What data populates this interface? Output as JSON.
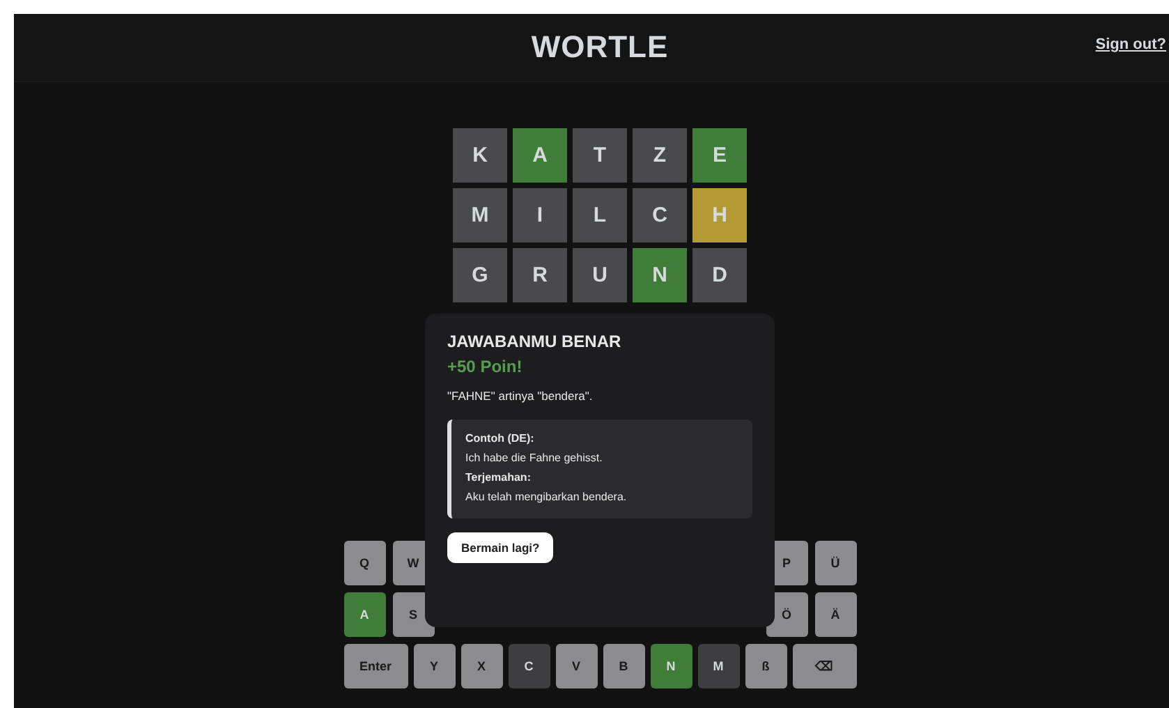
{
  "header": {
    "title": "WORTLE",
    "sign_out": "Sign out?"
  },
  "board": [
    [
      {
        "letter": "K",
        "color": "#4a4a4c"
      },
      {
        "letter": "A",
        "color": "#3f7d38"
      },
      {
        "letter": "T",
        "color": "#4a4a4c"
      },
      {
        "letter": "Z",
        "color": "#4a4a4c"
      },
      {
        "letter": "E",
        "color": "#3f7d38"
      }
    ],
    [
      {
        "letter": "M",
        "color": "#4a4a4c"
      },
      {
        "letter": "I",
        "color": "#4a4a4c"
      },
      {
        "letter": "L",
        "color": "#4a4a4c"
      },
      {
        "letter": "C",
        "color": "#4a4a4c"
      },
      {
        "letter": "H",
        "color": "#b29a35"
      }
    ],
    [
      {
        "letter": "G",
        "color": "#4a4a4c"
      },
      {
        "letter": "R",
        "color": "#4a4a4c"
      },
      {
        "letter": "U",
        "color": "#4a4a4c"
      },
      {
        "letter": "N",
        "color": "#3f7d38"
      },
      {
        "letter": "D",
        "color": "#4a4a4c"
      }
    ]
  ],
  "keyboard": [
    {
      "left": [
        {
          "label": "Q",
          "color": "#8c8c8e"
        },
        {
          "label": "W",
          "color": "#8c8c8e"
        }
      ],
      "right": [
        {
          "label": "P",
          "color": "#8c8c8e"
        },
        {
          "label": "Ü",
          "color": "#8c8c8e"
        }
      ]
    },
    {
      "left": [
        {
          "label": "A",
          "color": "#3f7d38"
        },
        {
          "label": "S",
          "color": "#8c8c8e"
        }
      ],
      "right": [
        {
          "label": "Ö",
          "color": "#8c8c8e"
        },
        {
          "label": "Ä",
          "color": "#8c8c8e"
        }
      ]
    },
    {
      "left": [
        {
          "label": "Enter",
          "color": "#8c8c8e",
          "kind": "wide"
        },
        {
          "label": "Y",
          "color": "#8c8c8e"
        },
        {
          "label": "X",
          "color": "#8c8c8e"
        },
        {
          "label": "C",
          "color": "#3e3e40"
        },
        {
          "label": "V",
          "color": "#8c8c8e"
        },
        {
          "label": "B",
          "color": "#8c8c8e"
        },
        {
          "label": "N",
          "color": "#3f7d38"
        },
        {
          "label": "M",
          "color": "#3e3e40"
        },
        {
          "label": "ß",
          "color": "#8c8c8e"
        },
        {
          "label": "⌫",
          "color": "#8c8c8e",
          "kind": "wide"
        }
      ]
    }
  ],
  "result_dialog": {
    "title": "JAWABANMU BENAR",
    "points": "+50 Poin!",
    "meaning": "\"FAHNE\" artinya \"bendera\".",
    "example_label": "Contoh (DE):",
    "example": "Ich habe die Fahne gehisst.",
    "translation_label": "Terjemahan:",
    "translation": "Aku telah mengibarkan bendera.",
    "button": "Bermain lagi?"
  }
}
